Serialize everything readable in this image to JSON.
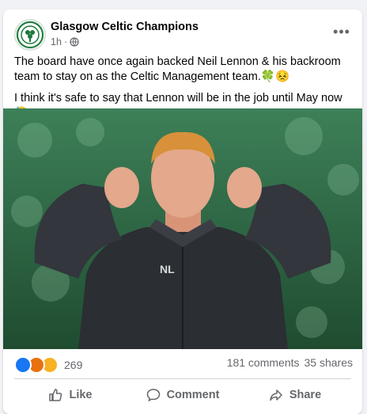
{
  "post": {
    "page_name": "Glasgow Celtic Champions",
    "time": "1h",
    "visibility_icon": "globe-icon",
    "more_icon": "more-options-icon",
    "paragraphs": [
      "The board have once again backed Neil Lennon & his backroom team to stay on as the Celtic Management team.🍀😣",
      "I think it's safe to say that Lennon will be in the job until May now😓"
    ],
    "photo_text": "NL"
  },
  "stats": {
    "reactions_count": "269",
    "comments": "181 comments",
    "shares": "35 shares"
  },
  "actions": {
    "like": "Like",
    "comment": "Comment",
    "share": "Share"
  },
  "colors": {
    "like_blue": "#1877f2",
    "angry_orange": "#e9710f",
    "haha_yellow": "#f7b125",
    "pitch_green": "#2f6b44"
  }
}
